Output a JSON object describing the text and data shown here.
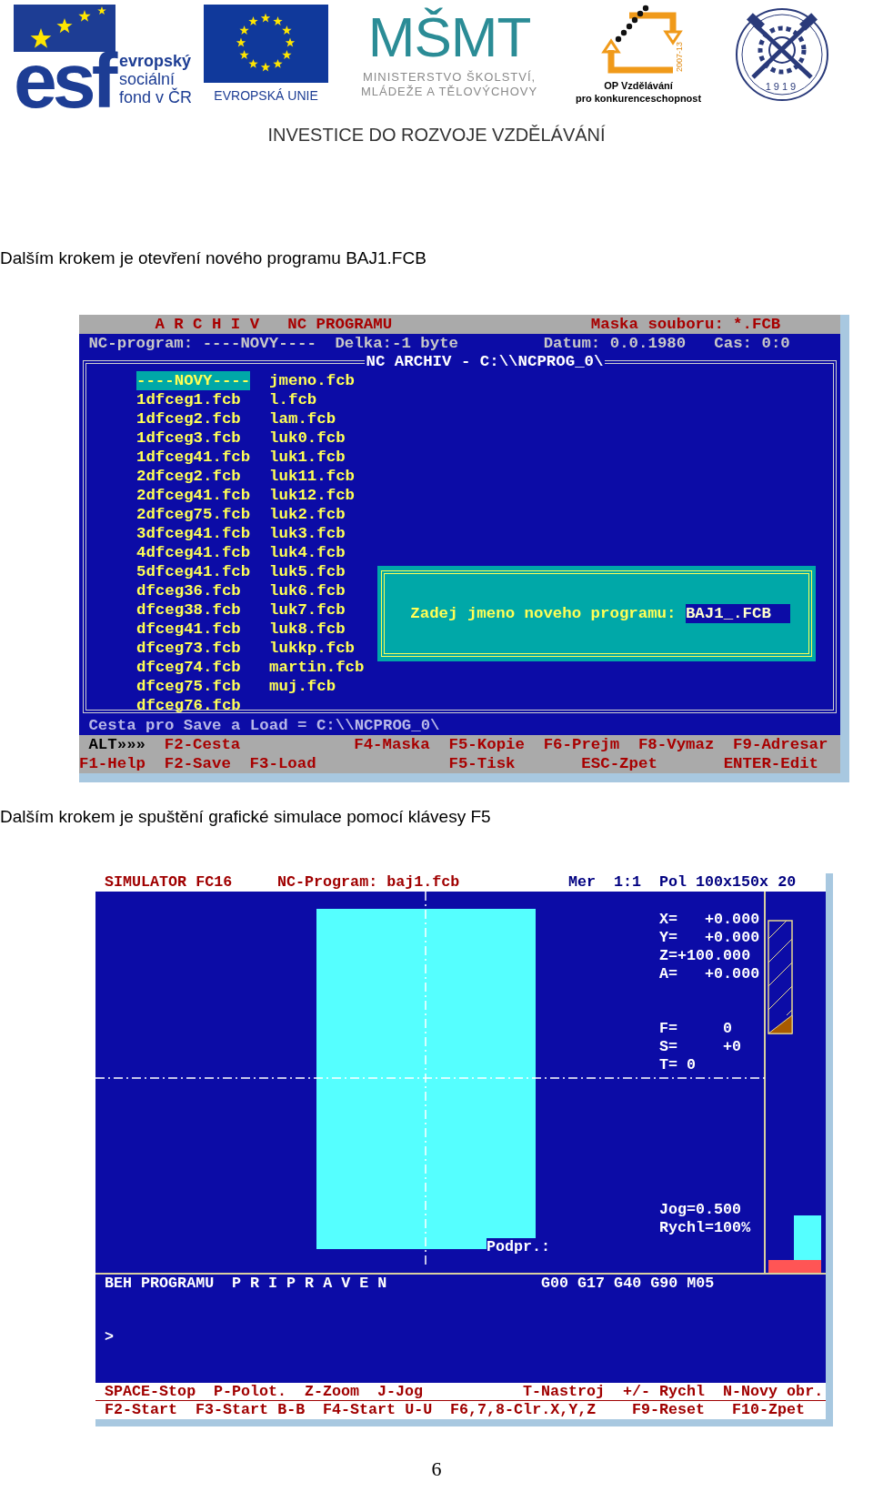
{
  "header": {
    "esf": {
      "mark": "esf",
      "lines": [
        "evropský",
        "sociální",
        "fond v ČR"
      ]
    },
    "eu": {
      "caption": "EVROPSKÁ UNIE"
    },
    "msmt": {
      "mark": "MŠMT",
      "lines": [
        "MINISTERSTVO ŠKOLSTVÍ,",
        "MLÁDEŽE A TĚLOVÝCHOVY"
      ]
    },
    "op": {
      "years": "2007-13",
      "lines": [
        "OP Vzdělávání",
        "pro konkurenceschopnost"
      ]
    },
    "emblem": {
      "year": "1919"
    },
    "tagline": "INVESTICE DO ROZVOJE VZDĚLÁVÁNÍ"
  },
  "caption_1": "Dalším krokem je otevření nového programu BAJ1.FCB",
  "archive_screen": {
    "title_bar": [
      "A R C H I V",
      "NC PROGRAMU",
      "Maska souboru:",
      "*.FCB"
    ],
    "info_bar": [
      "NC-program: ----NOVY----",
      "Delka:-1 byte",
      "Datum: 0.0.1980",
      "Cas: 0:0"
    ],
    "panel_title": "NC ARCHIV - C:\\\\NCPROG_0\\",
    "file_columns": [
      [
        {
          "name": "----NOVY----",
          "selected": true
        },
        {
          "name": "1dfceg1.fcb",
          "selected": false
        },
        {
          "name": "1dfceg2.fcb",
          "selected": false
        },
        {
          "name": "1dfceg3.fcb",
          "selected": false
        },
        {
          "name": "1dfceg41.fcb",
          "selected": false
        },
        {
          "name": "2dfceg2.fcb",
          "selected": false
        },
        {
          "name": "2dfceg41.fcb",
          "selected": false
        },
        {
          "name": "2dfceg75.fcb",
          "selected": false
        },
        {
          "name": "3dfceg41.fcb",
          "selected": false
        },
        {
          "name": "4dfceg41.fcb",
          "selected": false
        },
        {
          "name": "5dfceg41.fcb",
          "selected": false
        },
        {
          "name": "dfceg36.fcb",
          "selected": false
        },
        {
          "name": "dfceg38.fcb",
          "selected": false
        },
        {
          "name": "dfceg41.fcb",
          "selected": false
        },
        {
          "name": "dfceg73.fcb",
          "selected": false
        },
        {
          "name": "dfceg74.fcb",
          "selected": false
        },
        {
          "name": "dfceg75.fcb",
          "selected": false
        },
        {
          "name": "dfceg76.fcb",
          "selected": false
        }
      ],
      [
        {
          "name": "jmeno.fcb",
          "selected": false
        },
        {
          "name": "l.fcb",
          "selected": false
        },
        {
          "name": "lam.fcb",
          "selected": false
        },
        {
          "name": "luk0.fcb",
          "selected": false
        },
        {
          "name": "luk1.fcb",
          "selected": false
        },
        {
          "name": "luk11.fcb",
          "selected": false
        },
        {
          "name": "luk12.fcb",
          "selected": false
        },
        {
          "name": "luk2.fcb",
          "selected": false
        },
        {
          "name": "luk3.fcb",
          "selected": false
        },
        {
          "name": "luk4.fcb",
          "selected": false
        },
        {
          "name": "luk5.fcb",
          "selected": false
        },
        {
          "name": "luk6.fcb",
          "selected": false
        },
        {
          "name": "luk7.fcb",
          "selected": false
        },
        {
          "name": "luk8.fcb",
          "selected": false
        },
        {
          "name": "lukkp.fcb",
          "selected": false
        },
        {
          "name": "martin.fcb",
          "selected": false
        },
        {
          "name": "muj.fcb",
          "selected": false
        }
      ]
    ],
    "dialog": {
      "prompt": "Zadej jmeno noveho programu:",
      "value": "BAJ1_.FCB"
    },
    "path_line": "Cesta pro Save a Load = C:\\\\NCPROG_0\\",
    "key_rows": [
      [
        {
          "label": "ALT»»»",
          "kind": "modifier"
        },
        {
          "label": "F2-Cesta",
          "kind": "key"
        },
        {
          "label": "F4-Maska",
          "kind": "key"
        },
        {
          "label": "F5-Kopie",
          "kind": "key"
        },
        {
          "label": "F6-Prejm",
          "kind": "key"
        },
        {
          "label": "F8-Vymaz",
          "kind": "key"
        },
        {
          "label": "F9-Adresar",
          "kind": "key"
        }
      ],
      [
        {
          "label": "F1-Help",
          "kind": "key"
        },
        {
          "label": "F2-Save",
          "kind": "key"
        },
        {
          "label": "F3-Load",
          "kind": "key"
        },
        {
          "label": "F5-Tisk",
          "kind": "key"
        },
        {
          "label": "ESC-Zpet",
          "kind": "key"
        },
        {
          "label": "ENTER-Edit",
          "kind": "key"
        }
      ]
    ]
  },
  "caption_2": "Dalším krokem je spuštění grafické simulace pomocí klávesy F5",
  "simulator_screen": {
    "top_bar": [
      {
        "text": "SIMULATOR FC16",
        "color": "#a00000"
      },
      {
        "text": "NC-Program: baj1.fcb",
        "color": "#a00000"
      },
      {
        "text": "Mer",
        "color": "#000080"
      },
      {
        "text": "1:1",
        "color": "#000080"
      },
      {
        "text": "Pol",
        "color": "#000080"
      },
      {
        "text": "100x150x 20",
        "color": "#000080"
      }
    ],
    "coordinates": [
      "X=   +0.000",
      "Y=   +0.000",
      "Z=+100.000",
      "A=   +0.000"
    ],
    "spindle": [
      "F=     0",
      "S=     +0",
      "T= 0"
    ],
    "jog": [
      "Jog=0.500",
      "Rychl=100%"
    ],
    "support_label": "Podpr.:",
    "status": [
      "BEH PROGRAMU",
      "P R I P R A V E N",
      "G00 G17 G40 G90 M05"
    ],
    "prompt": ">",
    "key_rows": [
      [
        "SPACE-Stop",
        "P-Polot.",
        "Z-Zoom",
        "J-Jog",
        "T-Nastroj",
        "+/- Rychl",
        "N-Novy obr."
      ],
      [
        "F2-Start",
        "F3-Start B-B",
        "F4-Start U-U",
        "F6,7,8-Clr.X,Y,Z",
        "F9-Reset",
        "F10-Zpet"
      ]
    ]
  },
  "page_number": "6"
}
